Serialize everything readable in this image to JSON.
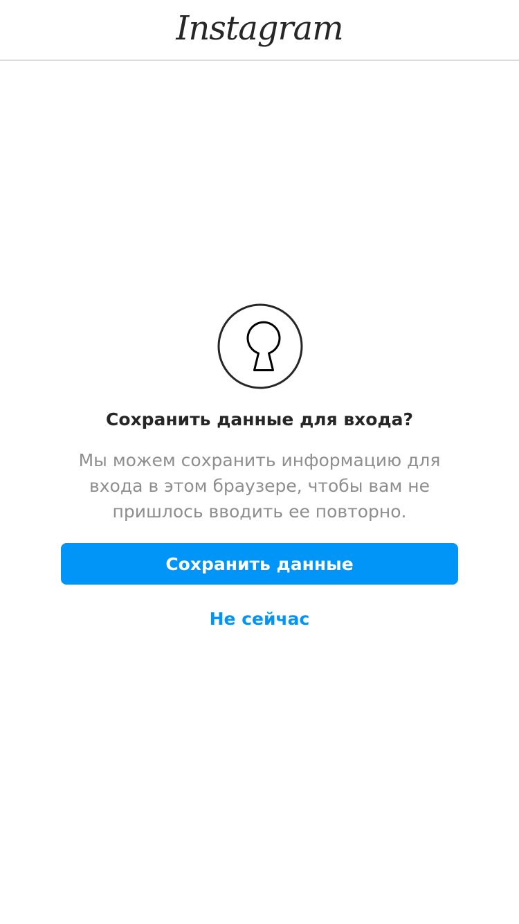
{
  "header": {
    "logo_text": "Instagram"
  },
  "icon": {
    "name": "keyhole-icon"
  },
  "dialog": {
    "title": "Сохранить данные для входа?",
    "description": "Мы можем сохранить информацию для входа в этом браузере, чтобы вам не пришлось вводить ее повторно.",
    "save_label": "Сохранить данные",
    "not_now_label": "Не сейчас"
  },
  "colors": {
    "primary_blue": "#0095f6",
    "text_dark": "#262626",
    "text_gray": "#8e8e8e",
    "border": "#dbdbdb"
  }
}
